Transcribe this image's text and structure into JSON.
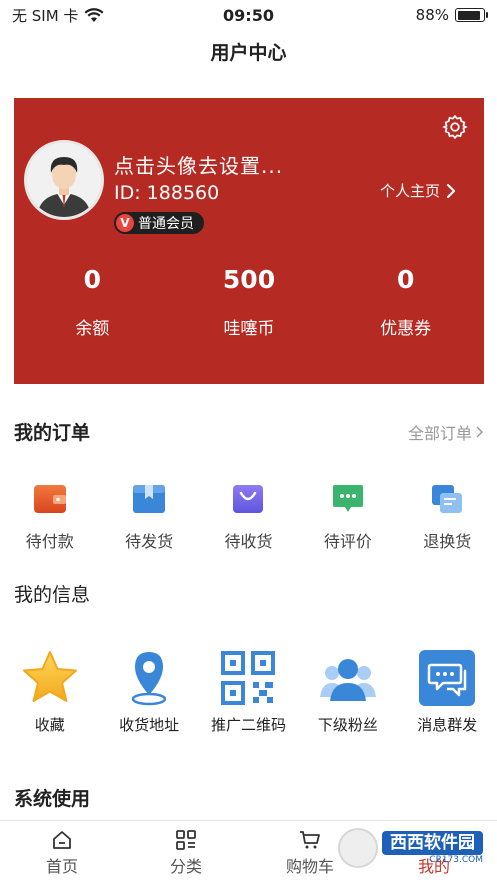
{
  "status": {
    "carrier": "无 SIM 卡",
    "time": "09:50",
    "battery": "88%",
    "battery_level": 0.88
  },
  "page": {
    "title": "用户中心"
  },
  "profile": {
    "name": "点击头像去设置...",
    "id_text": "ID: 188560",
    "badge_icon": "V",
    "badge": "普通会员",
    "homepage_link": "个人主页",
    "stats": [
      {
        "value": "0",
        "label": "余额"
      },
      {
        "value": "500",
        "label": "哇噻币"
      },
      {
        "value": "0",
        "label": "优惠券"
      }
    ]
  },
  "orders": {
    "title": "我的订单",
    "more": "全部订单",
    "items": [
      {
        "label": "待付款",
        "icon": "wallet-icon"
      },
      {
        "label": "待发货",
        "icon": "package-icon"
      },
      {
        "label": "待收货",
        "icon": "shopping-bag-icon"
      },
      {
        "label": "待评价",
        "icon": "comment-icon"
      },
      {
        "label": "退换货",
        "icon": "exchange-icon"
      }
    ]
  },
  "info": {
    "title": "我的信息",
    "items": [
      {
        "label": "收藏",
        "icon": "star-icon"
      },
      {
        "label": "收货地址",
        "icon": "location-pin-icon"
      },
      {
        "label": "推广二维码",
        "icon": "qr-code-icon"
      },
      {
        "label": "下级粉丝",
        "icon": "users-icon"
      },
      {
        "label": "消息群发",
        "icon": "message-icon"
      }
    ]
  },
  "system": {
    "title": "系统使用"
  },
  "tabs": [
    {
      "label": "首页",
      "icon": "home-icon"
    },
    {
      "label": "分类",
      "icon": "category-icon"
    },
    {
      "label": "购物车",
      "icon": "cart-icon"
    },
    {
      "label": "我的",
      "icon": "user-icon"
    }
  ],
  "watermark": {
    "text": "西西软件园",
    "url": "CR173.COM"
  },
  "colors": {
    "card_red": "#b52a22",
    "accent_blue": "#3a86d8",
    "accent_orange": "#e55a2b",
    "accent_green": "#3bb46e",
    "accent_yellow": "#f6c02b"
  }
}
